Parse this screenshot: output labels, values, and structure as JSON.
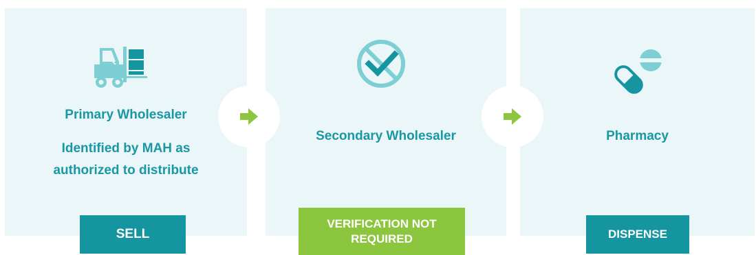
{
  "colors": {
    "panel_bg": "#eaf6f7",
    "teal": "#1a97a4",
    "icon_teal": "#7dcfd3",
    "badge_teal": "#15959f",
    "green": "#8cc63f"
  },
  "stages": [
    {
      "icon": "forklift-icon",
      "title": "Primary Wholesaler",
      "subtitle": "Identified by MAH as authorized to distribute",
      "badge": "SELL"
    },
    {
      "icon": "crossed-check-icon",
      "title": "Secondary Wholesaler",
      "badge": "VERIFICATION NOT REQUIRED"
    },
    {
      "icon": "pill-icon",
      "title": "Pharmacy",
      "badge": "DISPENSE"
    }
  ],
  "connectors": [
    {
      "icon": "arrow-right-icon"
    },
    {
      "icon": "arrow-right-icon"
    }
  ]
}
